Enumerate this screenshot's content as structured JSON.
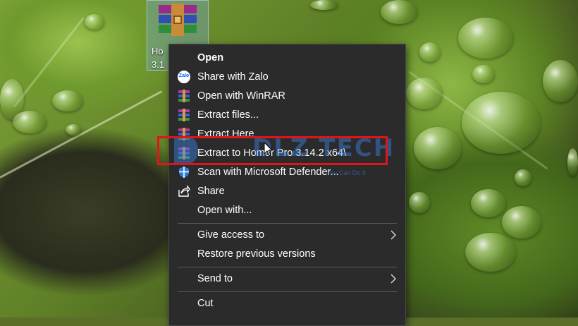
{
  "desktop": {
    "icon_label_line1": "Ho",
    "icon_label_line2": "3.1"
  },
  "context_menu": {
    "items": [
      {
        "label": "Open",
        "icon": "none",
        "bold": true
      },
      {
        "label": "Share with Zalo",
        "icon": "zalo-icon"
      },
      {
        "label": "Open with WinRAR",
        "icon": "winrar-icon"
      },
      {
        "label": "Extract files...",
        "icon": "winrar-icon"
      },
      {
        "label": "Extract Here",
        "icon": "winrar-icon"
      },
      {
        "label": "Extract to Homer Pro 3.14.2 x64\\",
        "icon": "winrar-icon",
        "highlighted": true
      },
      {
        "label": "Scan with Microsoft Defender...",
        "icon": "defender-shield-icon"
      },
      {
        "label": "Share",
        "icon": "share-icon"
      },
      {
        "label": "Open with...",
        "icon": "none"
      },
      {
        "label": "Give access to",
        "icon": "none",
        "submenu": true
      },
      {
        "label": "Restore previous versions",
        "icon": "none"
      },
      {
        "label": "Send to",
        "icon": "none",
        "submenu": true
      },
      {
        "label": "Cut",
        "icon": "none"
      }
    ]
  },
  "watermark": {
    "brand": "DLZ TECH",
    "tagline": "You Can Do It"
  },
  "colors": {
    "menu_bg": "#2b2b2b",
    "highlight_box": "#e0141b",
    "watermark": "#3c82e6"
  }
}
